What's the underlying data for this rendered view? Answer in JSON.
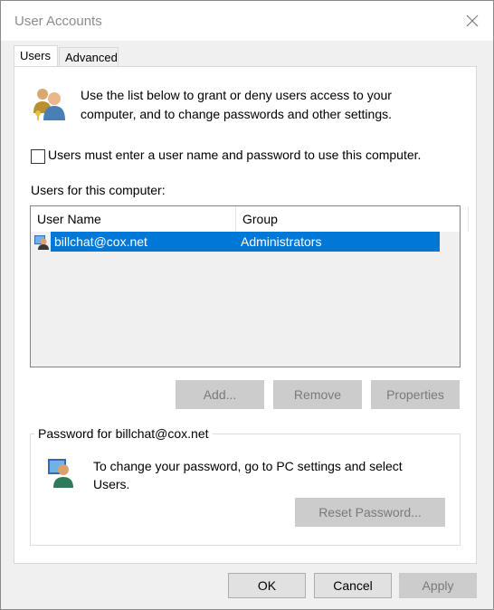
{
  "window": {
    "title": "User Accounts",
    "close_icon": "close-icon"
  },
  "tabs": [
    {
      "label": "Users",
      "selected": true
    },
    {
      "label": "Advanced",
      "selected": false
    }
  ],
  "users_tab": {
    "intro_text": "Use the list below to grant or deny users access to your computer, and to change passwords and other settings.",
    "require_login": {
      "label": "Users must enter a user name and password to use this computer.",
      "checked": false
    },
    "users_label": "Users for this computer:",
    "columns": [
      "User Name",
      "Group"
    ],
    "rows": [
      {
        "user_name": "billchat@cox.net",
        "group": "Administrators",
        "selected": true
      }
    ],
    "buttons": {
      "add": "Add...",
      "remove": "Remove",
      "properties": "Properties"
    },
    "password_group": {
      "label": "Password for billchat@cox.net",
      "text": "To change your password, go to PC settings and select Users.",
      "reset_button": "Reset Password..."
    }
  },
  "footer": {
    "ok": "OK",
    "cancel": "Cancel",
    "apply": "Apply"
  },
  "colors": {
    "selection": "#0078d7",
    "disabled_button": "#cccccc",
    "panel": "#ffffff",
    "chrome": "#f0f0f0"
  }
}
